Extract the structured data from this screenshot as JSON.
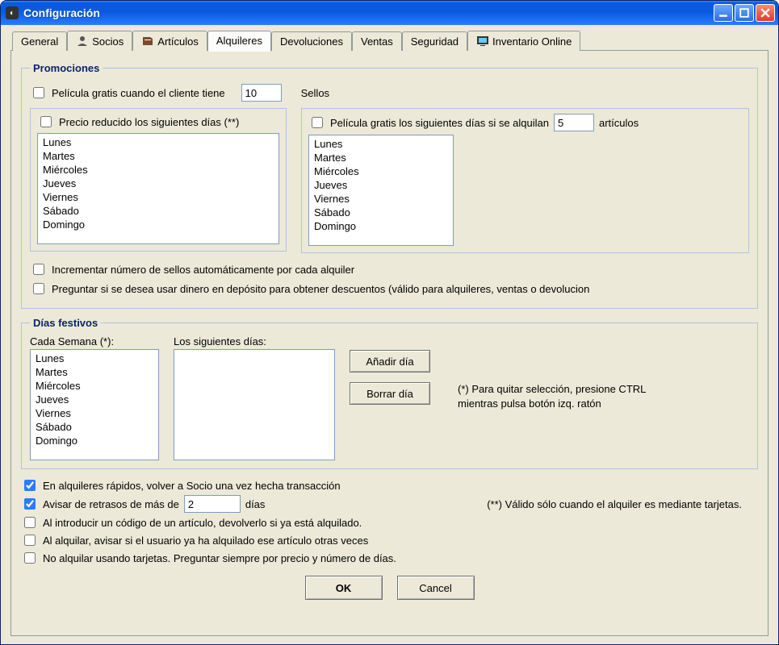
{
  "window": {
    "title": "Configuración"
  },
  "tabs": {
    "general": "General",
    "socios": "Socios",
    "articulos": "Artículos",
    "alquileres": "Alquileres",
    "devoluciones": "Devoluciones",
    "ventas": "Ventas",
    "seguridad": "Seguridad",
    "inventario": "Inventario Online"
  },
  "promociones": {
    "legend": "Promociones",
    "free_movie_label_pre": "Película gratis cuando el cliente tiene",
    "free_movie_value": "10",
    "free_movie_label_post": "Sellos",
    "reduced_price_label": "Precio reducido los siguientes días (**)",
    "free_days_label_pre": "Película gratis los siguientes días si se alquilan",
    "free_days_value": "5",
    "free_days_label_post": "artículos",
    "days1": [
      "Lunes",
      "Martes",
      "Miércoles",
      "Jueves",
      "Viernes",
      "Sábado",
      "Domingo"
    ],
    "days2": [
      "Lunes",
      "Martes",
      "Miércoles",
      "Jueves",
      "Viernes",
      "Sábado",
      "Domingo"
    ],
    "auto_stamps": "Incrementar número de sellos automáticamente por cada alquiler",
    "ask_deposit": "Preguntar si se desea usar dinero en depósito para obtener descuentos (válido para alquileres, ventas o devolucion"
  },
  "festivos": {
    "legend": "Días festivos",
    "cada_semana": "Cada Semana (*):",
    "los_siguientes": "Los siguientes días:",
    "week_days": [
      "Lunes",
      "Martes",
      "Miércoles",
      "Jueves",
      "Viernes",
      "Sábado",
      "Domingo"
    ],
    "add_btn": "Añadir día",
    "del_btn": "Borrar día",
    "hint": "(*) Para quitar selección, presione CTRL mientras pulsa botón izq. ratón"
  },
  "bottom": {
    "rapidos": "En alquileres rápidos, volver a Socio una vez hecha transacción",
    "avisar_pre": "Avisar de retrasos de más de",
    "avisar_value": "2",
    "avisar_post": "días",
    "tarjetas_note": "(**) Válido sólo cuando el alquiler es mediante tarjetas.",
    "devolver": "Al introducir un código de un artículo, devolverlo si ya está alquilado.",
    "avisar_alq": "Al alquilar, avisar si el usuario ya ha alquilado ese artículo otras veces",
    "no_tarjetas": "No alquilar usando tarjetas. Preguntar siempre por precio y número de días."
  },
  "buttons": {
    "ok": "OK",
    "cancel": "Cancel"
  }
}
